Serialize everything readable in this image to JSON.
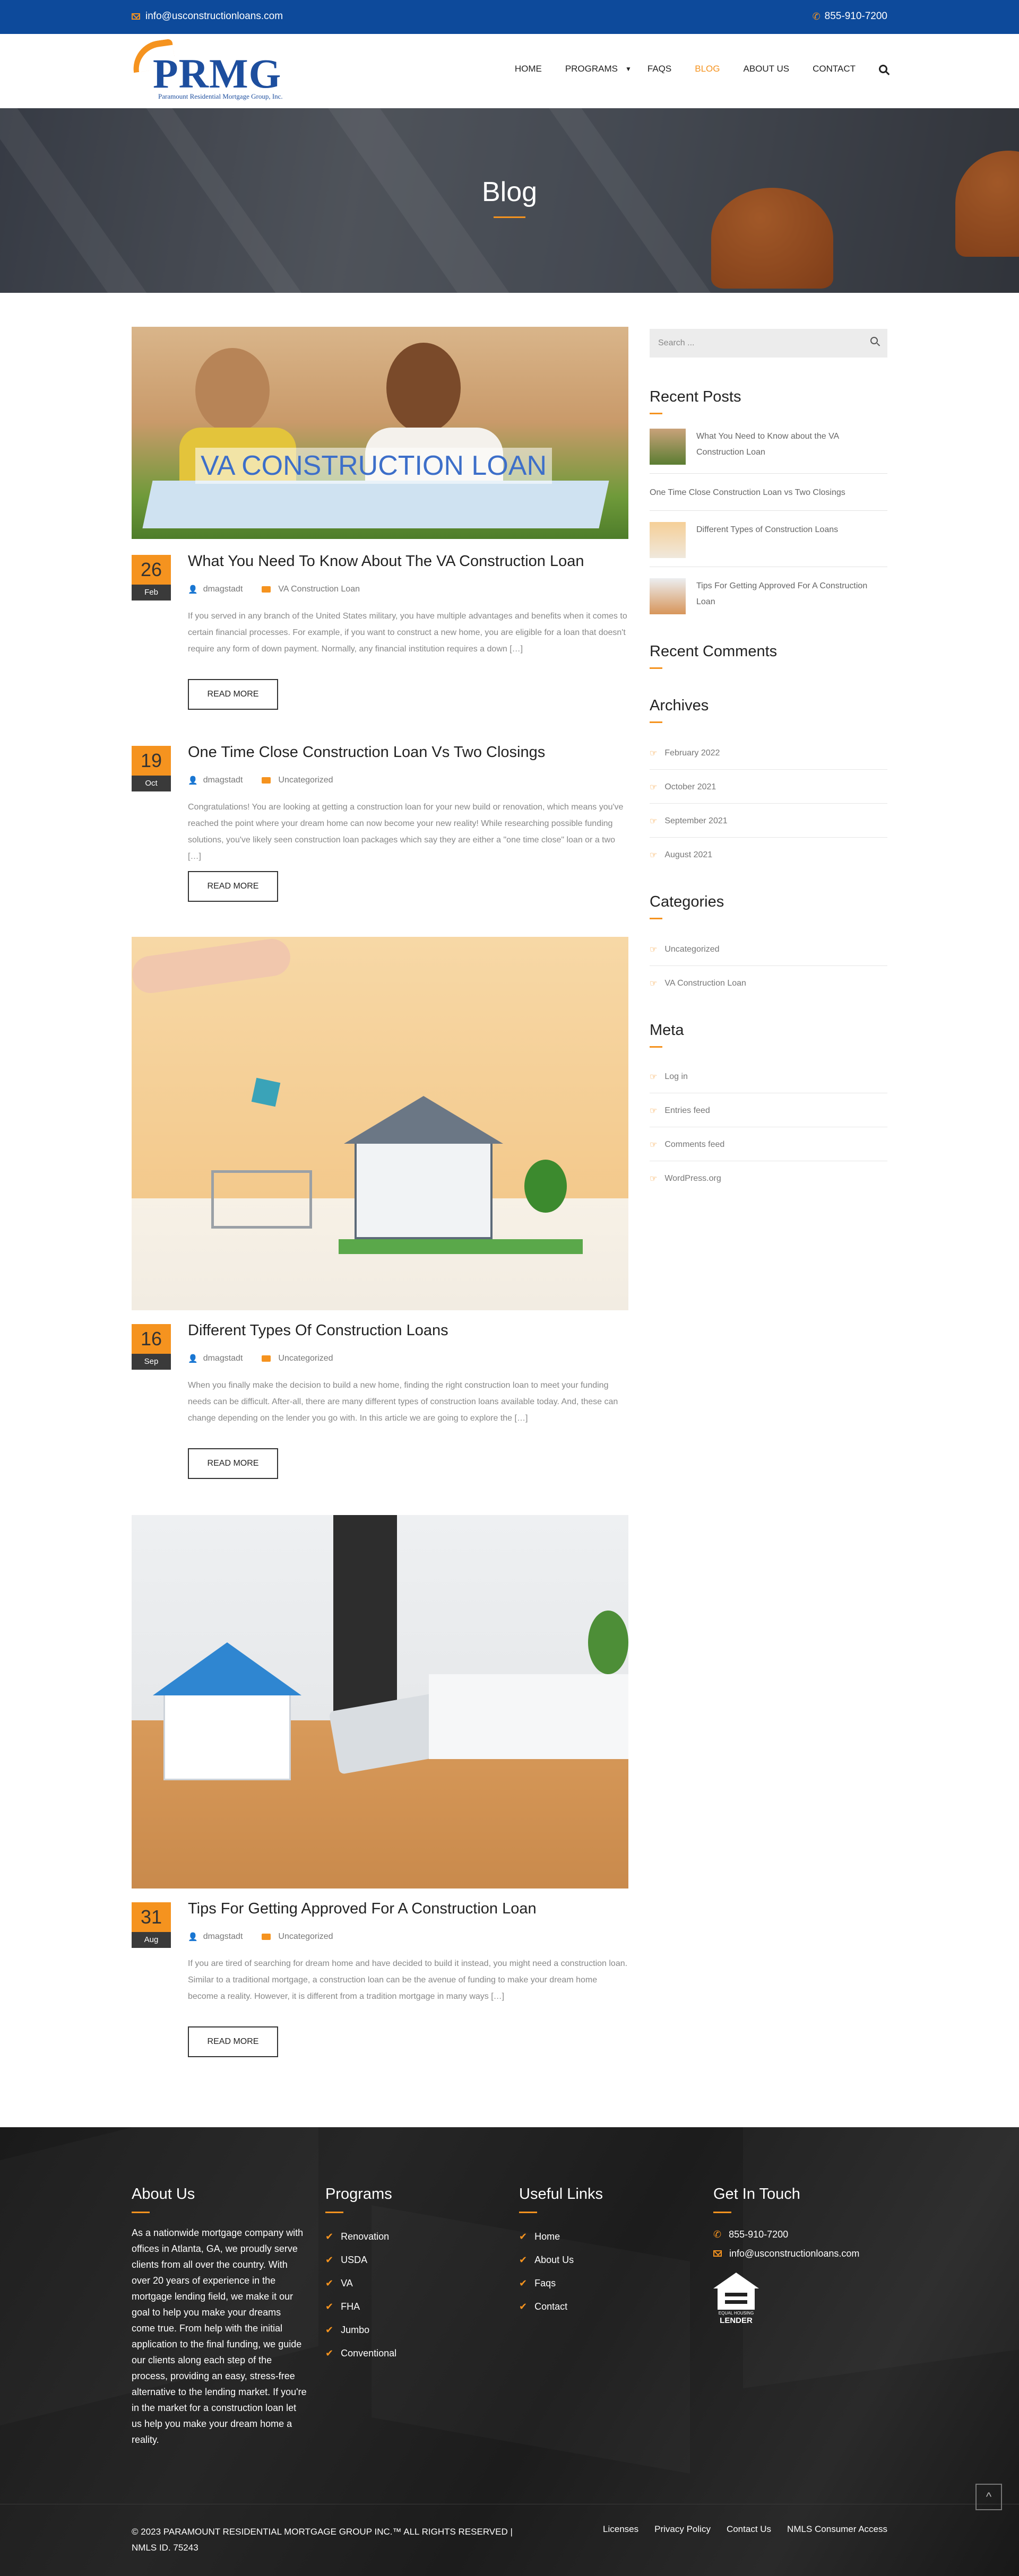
{
  "topbar": {
    "email": "info@usconstructionloans.com",
    "phone": "855-910-7200"
  },
  "logo": {
    "text": "PRMG",
    "subtitle": "Paramount Residential Mortgage Group, Inc."
  },
  "nav": {
    "items": [
      "HOME",
      "PROGRAMS",
      "FAQS",
      "BLOG",
      "ABOUT US",
      "CONTACT"
    ],
    "active": "BLOG"
  },
  "hero": {
    "title": "Blog"
  },
  "posts": [
    {
      "day": "26",
      "month": "Feb",
      "title": "What You Need To Know About The VA Construction Loan",
      "author": "dmagstadt",
      "category": "VA Construction Loan",
      "image_caption": "VA CONSTRUCTION LOAN",
      "excerpt": "If you served in any branch of the United States military, you have multiple advantages and benefits when it comes to certain financial processes. For example, if you want to construct a new home, you are eligible for a loan that doesn't require any form of down payment. Normally, any financial institution requires a down […]",
      "button": "READ MORE"
    },
    {
      "day": "19",
      "month": "Oct",
      "title": "One Time Close Construction Loan Vs Two Closings",
      "author": "dmagstadt",
      "category": "Uncategorized",
      "excerpt": "Congratulations! You are looking at getting a construction loan for your new build or renovation, which means you've reached the point where your dream home can now become your new reality! While researching possible funding solutions, you've likely seen construction loan packages which say they are either a \"one time close\" loan or a two […]",
      "button": "READ MORE"
    },
    {
      "day": "16",
      "month": "Sep",
      "title": "Different Types Of Construction Loans",
      "author": "dmagstadt",
      "category": "Uncategorized",
      "excerpt": "When you finally make the decision to build a new home, finding the right construction loan to meet your funding needs can be difficult. After-all, there are many different types of construction loans available today. And, these can change depending on the lender you go with. In this article we are going to explore the […]",
      "button": "READ MORE"
    },
    {
      "day": "31",
      "month": "Aug",
      "title": "Tips For Getting Approved For A Construction Loan",
      "author": "dmagstadt",
      "category": "Uncategorized",
      "excerpt": "If you are tired of searching for dream home and have decided to build it instead, you might need a construction loan. Similar to a traditional mortgage, a construction loan can be the avenue of funding to make your dream home become a reality. However, it is different from a tradition mortgage in many ways […]",
      "button": "READ MORE"
    }
  ],
  "sidebar": {
    "search_placeholder": "Search ...",
    "recent_posts_title": "Recent Posts",
    "recent_posts": [
      "What You Need to Know about the VA Construction Loan",
      "One Time Close Construction Loan vs Two Closings",
      "Different Types of Construction Loans",
      "Tips For Getting Approved For A Construction Loan"
    ],
    "recent_comments_title": "Recent Comments",
    "archives_title": "Archives",
    "archives": [
      "February 2022",
      "October 2021",
      "September 2021",
      "August 2021"
    ],
    "categories_title": "Categories",
    "categories": [
      "Uncategorized",
      "VA Construction Loan"
    ],
    "meta_title": "Meta",
    "meta": [
      "Log in",
      "Entries feed",
      "Comments feed",
      "WordPress.org"
    ]
  },
  "footer": {
    "about_title": "About Us",
    "about_text": "As a nationwide mortgage company with offices in Atlanta, GA, we proudly serve clients from all over the country. With over 20 years of experience in the mortgage lending field, we make it our goal to help you make your dreams come true. From help with the initial application to the final funding, we guide our clients along each step of the process, providing an easy, stress-free alternative to the lending market. If you're in the market for a construction loan let us help you make your dream home a reality.",
    "programs_title": "Programs",
    "programs": [
      "Renovation",
      "USDA",
      "VA",
      "FHA",
      "Jumbo",
      "Conventional"
    ],
    "links_title": "Useful Links",
    "links": [
      "Home",
      "About Us",
      "Faqs",
      "Contact"
    ],
    "contact_title": "Get In Touch",
    "phone": "855-910-7200",
    "email": "info@usconstructionloans.com",
    "ehl_small": "EQUAL HOUSING",
    "ehl_big": "LENDER",
    "copyright": "© 2023 PARAMOUNT RESIDENTIAL MORTGAGE GROUP INC.™ ALL RIGHTS RESERVED | NMLS ID. 75243",
    "bottom_links": [
      "Licenses",
      "Privacy Policy",
      "Contact Us",
      "NMLS Consumer Access"
    ],
    "to_top": "^"
  },
  "colors": {
    "accent": "#f5931f",
    "topbar": "#0d4a9b",
    "brand_blue": "#1d4e9e",
    "footer_bg": "#1e1e1e"
  }
}
